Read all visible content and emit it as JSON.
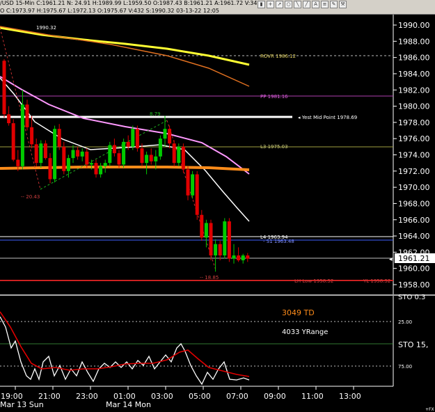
{
  "window": {
    "title": "/USD 15-Min C:1961.21 N: 24.91 H:1989.99 L:1959.50 O:1987.43 B:1961.21 A:1961.72 V:34.5",
    "quote": "O C:1973.97 H:1975.67 L:1972.13 O:1975.67 V:432 S:1990.32 03-13-22 12:05"
  },
  "toolbar": {
    "icons": [
      "bar-icon",
      "plus-icon",
      "arrow-icon",
      "ellipse-icon",
      "line-icon",
      "line-icon",
      "text-icon",
      "fib-icon",
      "pencil-icon",
      "tools-icon"
    ]
  },
  "price_axis": {
    "ticks": [
      "1990.00",
      "1988.00",
      "1986.00",
      "1984.00",
      "1982.00",
      "1980.00",
      "1978.00",
      "1976.00",
      "1974.00",
      "1972.00",
      "1970.00",
      "1968.00",
      "1966.00",
      "1964.00",
      "1962.00",
      "1960.00",
      "1958.00"
    ],
    "current_price": "1961.21",
    "partial_label": "STO 0.3"
  },
  "levels": {
    "rovr": "ROVR 1986.12",
    "pp": "PP 1981.16",
    "yest_mid": "Yest Mid Point 1978.69",
    "l3": "L3 1975.03",
    "l4": "L4 1963.94",
    "s1": "S1 1963.48",
    "lh_low": "LH Low 1958.52",
    "yl": "YL 1958.52"
  },
  "annotations": {
    "high": "1990.32",
    "swing_up": "8.79",
    "swing_low_left": "-- 20.43",
    "swing_low_right": "-- 18.85"
  },
  "indicator": {
    "td": "3049 TD",
    "yrange": "4033 YRange",
    "sto": "STO 15,",
    "ticks": [
      "25.00",
      "75.00"
    ]
  },
  "time_axis": {
    "labels": [
      "19:00",
      "21:00",
      "23:00",
      "01:00",
      "03:00",
      "05:00",
      "07:00",
      "09:00",
      "11:00",
      "13:00"
    ],
    "dates": [
      "Mar 13 Sun",
      "Mar 14 Mon"
    ],
    "corner": "+FX"
  },
  "colors": {
    "bull": "#00cc00",
    "bear": "#e00000",
    "yellow_ma": "#ffff33",
    "orange_ma": "#e07020",
    "magenta_ma": "#ff99ff",
    "white_ma": "#ffffff",
    "thick_orange": "#ff8c1a"
  },
  "candles": [
    {
      "t": 0,
      "o": 1985.6,
      "h": 1985.8,
      "l": 1978.6,
      "c": 1979.0
    },
    {
      "t": 1,
      "o": 1979.0,
      "h": 1980.0,
      "l": 1977.6,
      "c": 1977.9
    },
    {
      "t": 2,
      "o": 1977.9,
      "h": 1978.4,
      "l": 1973.2,
      "c": 1973.4
    },
    {
      "t": 3,
      "o": 1973.4,
      "h": 1974.6,
      "l": 1972.0,
      "c": 1972.6
    },
    {
      "t": 4,
      "o": 1972.6,
      "h": 1982.0,
      "l": 1972.2,
      "c": 1980.2
    },
    {
      "t": 5,
      "o": 1980.2,
      "h": 1980.8,
      "l": 1977.0,
      "c": 1977.4
    },
    {
      "t": 6,
      "o": 1977.4,
      "h": 1978.8,
      "l": 1974.8,
      "c": 1975.3
    },
    {
      "t": 7,
      "o": 1975.3,
      "h": 1976.0,
      "l": 1972.6,
      "c": 1973.0
    },
    {
      "t": 8,
      "o": 1973.0,
      "h": 1975.8,
      "l": 1972.4,
      "c": 1975.4
    },
    {
      "t": 9,
      "o": 1975.4,
      "h": 1975.8,
      "l": 1973.4,
      "c": 1973.6
    },
    {
      "t": 10,
      "o": 1973.6,
      "h": 1974.2,
      "l": 1970.5,
      "c": 1971.0
    },
    {
      "t": 11,
      "o": 1971.0,
      "h": 1977.6,
      "l": 1970.6,
      "c": 1977.2
    },
    {
      "t": 12,
      "o": 1977.2,
      "h": 1977.8,
      "l": 1974.6,
      "c": 1975.0
    },
    {
      "t": 13,
      "o": 1975.0,
      "h": 1975.6,
      "l": 1971.6,
      "c": 1972.0
    },
    {
      "t": 14,
      "o": 1972.0,
      "h": 1974.0,
      "l": 1971.2,
      "c": 1973.6
    },
    {
      "t": 15,
      "o": 1973.6,
      "h": 1975.2,
      "l": 1973.0,
      "c": 1974.6
    },
    {
      "t": 16,
      "o": 1974.6,
      "h": 1975.0,
      "l": 1973.4,
      "c": 1973.8
    },
    {
      "t": 17,
      "o": 1973.8,
      "h": 1974.8,
      "l": 1973.2,
      "c": 1974.4
    },
    {
      "t": 18,
      "o": 1974.4,
      "h": 1974.8,
      "l": 1972.4,
      "c": 1972.8
    },
    {
      "t": 19,
      "o": 1972.8,
      "h": 1973.4,
      "l": 1972.2,
      "c": 1973.0
    },
    {
      "t": 20,
      "o": 1973.0,
      "h": 1973.4,
      "l": 1971.2,
      "c": 1971.6
    },
    {
      "t": 21,
      "o": 1971.6,
      "h": 1973.0,
      "l": 1971.2,
      "c": 1972.6
    },
    {
      "t": 22,
      "o": 1972.6,
      "h": 1973.4,
      "l": 1971.8,
      "c": 1973.0
    },
    {
      "t": 23,
      "o": 1973.0,
      "h": 1975.6,
      "l": 1972.6,
      "c": 1975.2
    },
    {
      "t": 24,
      "o": 1975.2,
      "h": 1976.0,
      "l": 1973.8,
      "c": 1974.2
    },
    {
      "t": 25,
      "o": 1974.2,
      "h": 1974.6,
      "l": 1972.4,
      "c": 1972.8
    },
    {
      "t": 26,
      "o": 1972.8,
      "h": 1976.0,
      "l": 1972.4,
      "c": 1975.6
    },
    {
      "t": 27,
      "o": 1975.6,
      "h": 1976.4,
      "l": 1974.6,
      "c": 1975.0
    },
    {
      "t": 28,
      "o": 1975.0,
      "h": 1977.6,
      "l": 1974.6,
      "c": 1977.2
    },
    {
      "t": 29,
      "o": 1977.2,
      "h": 1977.6,
      "l": 1974.4,
      "c": 1974.8
    },
    {
      "t": 30,
      "o": 1974.8,
      "h": 1975.4,
      "l": 1972.6,
      "c": 1973.0
    },
    {
      "t": 31,
      "o": 1973.0,
      "h": 1974.4,
      "l": 1971.6,
      "c": 1974.0
    },
    {
      "t": 32,
      "o": 1974.0,
      "h": 1974.8,
      "l": 1972.8,
      "c": 1973.2
    },
    {
      "t": 33,
      "o": 1973.2,
      "h": 1974.6,
      "l": 1972.2,
      "c": 1973.8
    },
    {
      "t": 34,
      "o": 1973.8,
      "h": 1976.4,
      "l": 1973.4,
      "c": 1976.0
    },
    {
      "t": 35,
      "o": 1976.0,
      "h": 1978.8,
      "l": 1975.0,
      "c": 1977.2
    },
    {
      "t": 36,
      "o": 1977.2,
      "h": 1977.6,
      "l": 1974.8,
      "c": 1975.4
    },
    {
      "t": 37,
      "o": 1975.4,
      "h": 1975.8,
      "l": 1972.6,
      "c": 1973.0
    },
    {
      "t": 38,
      "o": 1973.0,
      "h": 1975.4,
      "l": 1972.6,
      "c": 1975.0
    },
    {
      "t": 39,
      "o": 1975.0,
      "h": 1975.4,
      "l": 1971.8,
      "c": 1972.2
    },
    {
      "t": 40,
      "o": 1972.2,
      "h": 1972.6,
      "l": 1968.4,
      "c": 1969.0
    },
    {
      "t": 41,
      "o": 1969.0,
      "h": 1972.0,
      "l": 1968.6,
      "c": 1971.6
    },
    {
      "t": 42,
      "o": 1971.6,
      "h": 1972.0,
      "l": 1966.0,
      "c": 1966.6
    },
    {
      "t": 43,
      "o": 1966.6,
      "h": 1967.2,
      "l": 1963.4,
      "c": 1963.8
    },
    {
      "t": 44,
      "o": 1963.8,
      "h": 1966.0,
      "l": 1962.6,
      "c": 1965.6
    },
    {
      "t": 45,
      "o": 1965.6,
      "h": 1966.0,
      "l": 1961.0,
      "c": 1961.6
    },
    {
      "t": 46,
      "o": 1961.6,
      "h": 1963.6,
      "l": 1959.6,
      "c": 1963.0
    },
    {
      "t": 47,
      "o": 1963.0,
      "h": 1963.4,
      "l": 1961.0,
      "c": 1961.6
    },
    {
      "t": 48,
      "o": 1961.6,
      "h": 1966.2,
      "l": 1961.2,
      "c": 1965.8
    },
    {
      "t": 49,
      "o": 1965.8,
      "h": 1966.2,
      "l": 1960.8,
      "c": 1961.2
    },
    {
      "t": 50,
      "o": 1961.2,
      "h": 1963.0,
      "l": 1960.6,
      "c": 1961.6
    },
    {
      "t": 51,
      "o": 1961.6,
      "h": 1962.6,
      "l": 1960.8,
      "c": 1961.0
    },
    {
      "t": 52,
      "o": 1961.0,
      "h": 1961.8,
      "l": 1960.6,
      "c": 1961.6
    },
    {
      "t": 53,
      "o": 1961.6,
      "h": 1961.9,
      "l": 1960.8,
      "c": 1961.2
    }
  ]
}
